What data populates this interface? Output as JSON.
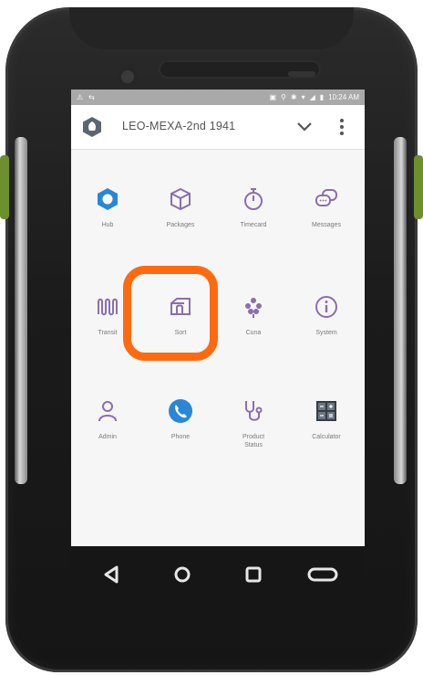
{
  "status_bar": {
    "time": "10:24 AM",
    "left_icons": [
      "warning-icon",
      "sync-icon"
    ],
    "right_icons": [
      "nfc-icon",
      "location-icon",
      "bluetooth-icon",
      "wifi-icon",
      "signal-icon",
      "battery-icon"
    ]
  },
  "app_bar": {
    "title": "LEO-MEXA-2nd 1941",
    "logo_icon": "hexagon-logo-icon",
    "dropdown_icon": "chevron-down-icon",
    "menu_icon": "overflow-menu-icon"
  },
  "apps": [
    {
      "label": "Hub",
      "icon": "hub-icon"
    },
    {
      "label": "Packages",
      "icon": "package-icon"
    },
    {
      "label": "Timecard",
      "icon": "stopwatch-icon"
    },
    {
      "label": "Messages",
      "icon": "chat-bubbles-icon"
    },
    {
      "label": "Transit",
      "icon": "transit-icon"
    },
    {
      "label": "Sort",
      "icon": "sort-box-icon"
    },
    {
      "label": "Cuna",
      "icon": "cluster-icon"
    },
    {
      "label": "System",
      "icon": "info-icon"
    },
    {
      "label": "Admin",
      "icon": "person-icon"
    },
    {
      "label": "Phone",
      "icon": "phone-icon"
    },
    {
      "label": "Product\nStatus",
      "icon": "stethoscope-icon"
    },
    {
      "label": "Calculator",
      "icon": "calculator-icon"
    }
  ],
  "highlighted_app": "Sort",
  "colors": {
    "highlight": "#ff6a10",
    "accent_blue": "#2a86d6",
    "icon_purple": "#8a6fae",
    "status_bar": "#a9a9a9"
  },
  "nav_bar": {
    "buttons": [
      "back-icon",
      "home-icon",
      "recents-icon",
      "menu-pill-icon"
    ]
  }
}
